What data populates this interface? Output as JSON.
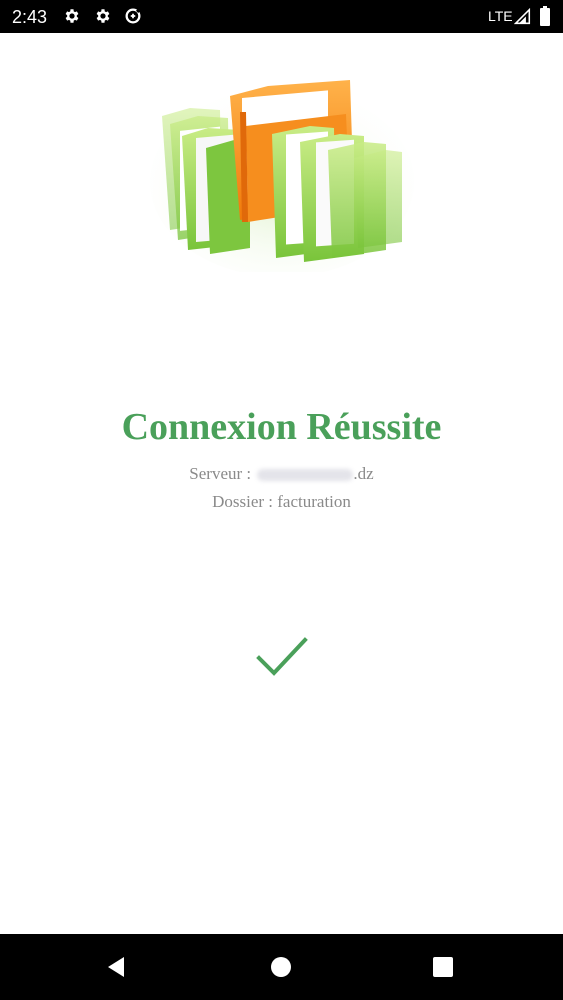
{
  "status_bar": {
    "time": "2:43",
    "icons_left": [
      "settings-gear-icon",
      "settings-gear-icon",
      "data-saver-icon"
    ],
    "network": "LTE",
    "icons_right": [
      "signal-icon",
      "battery-icon"
    ]
  },
  "main": {
    "title": "Connexion Réussite",
    "server_label": "Serveur :",
    "server_value_suffix": ".dz",
    "folder_label": "Dossier :",
    "folder_value": "facturation",
    "accent_color": "#4aa05a"
  },
  "nav_bar": {
    "icons": [
      "back-icon",
      "home-icon",
      "recents-icon"
    ]
  }
}
